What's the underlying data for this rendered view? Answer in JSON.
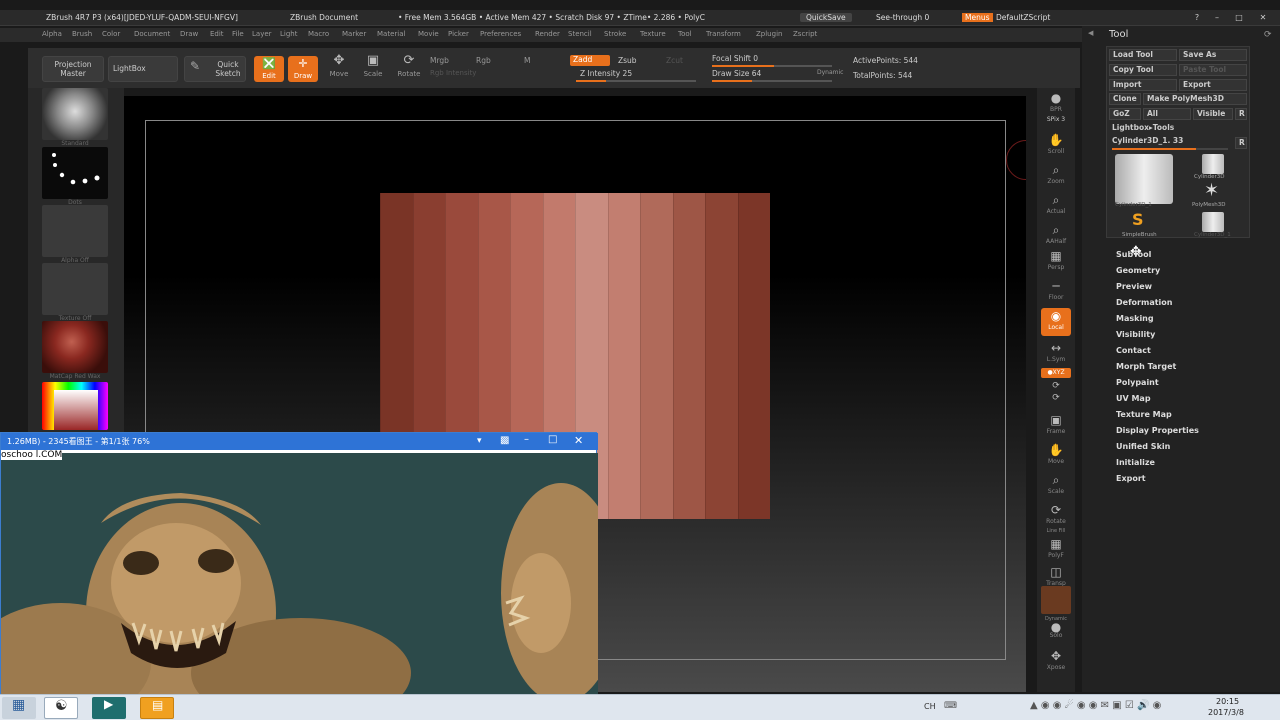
{
  "titlebar": {
    "app": "ZBrush 4R7 P3 (x64)[JDED-YLUF-QADM-SEUI-NFGV]",
    "doc": "ZBrush Document",
    "stats": "• Free Mem 3.564GB • Active Mem 427 • Scratch Disk 97 • ZTime• 2.286 • PolyC",
    "quicksave": "QuickSave",
    "see_through": "See-through  0",
    "menus": "Menus",
    "script": "DefaultZScript"
  },
  "menu": [
    "Alpha",
    "Brush",
    "Color",
    "Document",
    "Draw",
    "Edit",
    "File",
    "Layer",
    "Light",
    "Macro",
    "Marker",
    "Material",
    "Movie",
    "Picker",
    "Preferences",
    "Render",
    "Stencil",
    "Stroke",
    "Texture",
    "Tool",
    "Transform",
    "Zplugin",
    "Zscript"
  ],
  "toolbar": {
    "projection_master": "Projection Master",
    "lightbox": "LightBox",
    "quick_sketch": "Quick Sketch",
    "edit": "Edit",
    "draw": "Draw",
    "move": "Move",
    "scale": "Scale",
    "rotate": "Rotate",
    "mrgb": "Mrgb",
    "rgb": "Rgb",
    "m": "M",
    "rgb_intensity": "Rgb Intensity",
    "zadd": "Zadd",
    "zsub": "Zsub",
    "zcut": "Zcut",
    "z_intensity": "Z Intensity 25",
    "z_intensity_value": 25,
    "focal_shift": "Focal Shift 0",
    "draw_size": "Draw Size 64",
    "dynamic": "Dynamic",
    "active_points": "ActivePoints: 544",
    "total_points": "TotalPoints: 544"
  },
  "left_panel": {
    "standard": "Standard",
    "dots": "Dots",
    "alpha": "Alpha  Off",
    "texture": "Texture  Off",
    "matcap": "MatCap  Red  Wax"
  },
  "right_icons": {
    "bpr": "BPR",
    "spix": "SPix 3",
    "scroll": "Scroll",
    "zoom": "Zoom",
    "actual": "Actual",
    "aahalf": "AAHalf",
    "dynamic": "Dynamic",
    "persp": "Persp",
    "floor": "Floor",
    "local": "Local",
    "lsym": "L.Sym",
    "xyz": "●XYZ",
    "frame": "Frame",
    "move": "Move",
    "scale": "Scale",
    "rotate": "Rotate",
    "linefill": "Line Fill",
    "polyf": "PolyF",
    "transp": "Transp",
    "dynamic2": "Dynamic",
    "solo": "Solo",
    "xpose": "Xpose"
  },
  "tool_panel": {
    "title": "Tool",
    "load_tool": "Load Tool",
    "save_as": "Save As",
    "copy_tool": "Copy Tool",
    "paste_tool": "Paste Tool",
    "import": "Import",
    "export": "Export",
    "clone": "Clone",
    "make_polymesh": "Make PolyMesh3D",
    "goz": "GoZ",
    "all": "All",
    "visible": "Visible",
    "r": "R",
    "lightbox_tools": "Lightbox▸Tools",
    "current_tool": "Cylinder3D_1. 33",
    "thumb_labels": [
      "Cylinder3D_1",
      "Cylinder3D",
      "PolyMesh3D",
      "SimpleBrush",
      "Cylinder3D_1"
    ],
    "subpanels": [
      "SubTool",
      "Geometry",
      "Preview",
      "Deformation",
      "Masking",
      "Visibility",
      "Contact",
      "Morph Target",
      "Polypaint",
      "UV Map",
      "Texture Map",
      "Display Properties",
      "Unified Skin",
      "Initialize",
      "Export"
    ]
  },
  "viewer": {
    "title": "1.26MB) - 2345看图王 - 第1/1张 76%",
    "watermark": "oschoo l.COM"
  },
  "taskbar": {
    "lang": "CH",
    "time": "20:15",
    "date": "2017/3/8"
  },
  "colors": {
    "accent": "#e8701c",
    "cylinder": [
      "#7a3426",
      "#8a3e30",
      "#9a4a3c",
      "#a85748",
      "#b66758",
      "#c27a6c",
      "#c98c80",
      "#c27e70",
      "#b06a5a",
      "#9e5646",
      "#8c4434",
      "#7c3628"
    ]
  }
}
